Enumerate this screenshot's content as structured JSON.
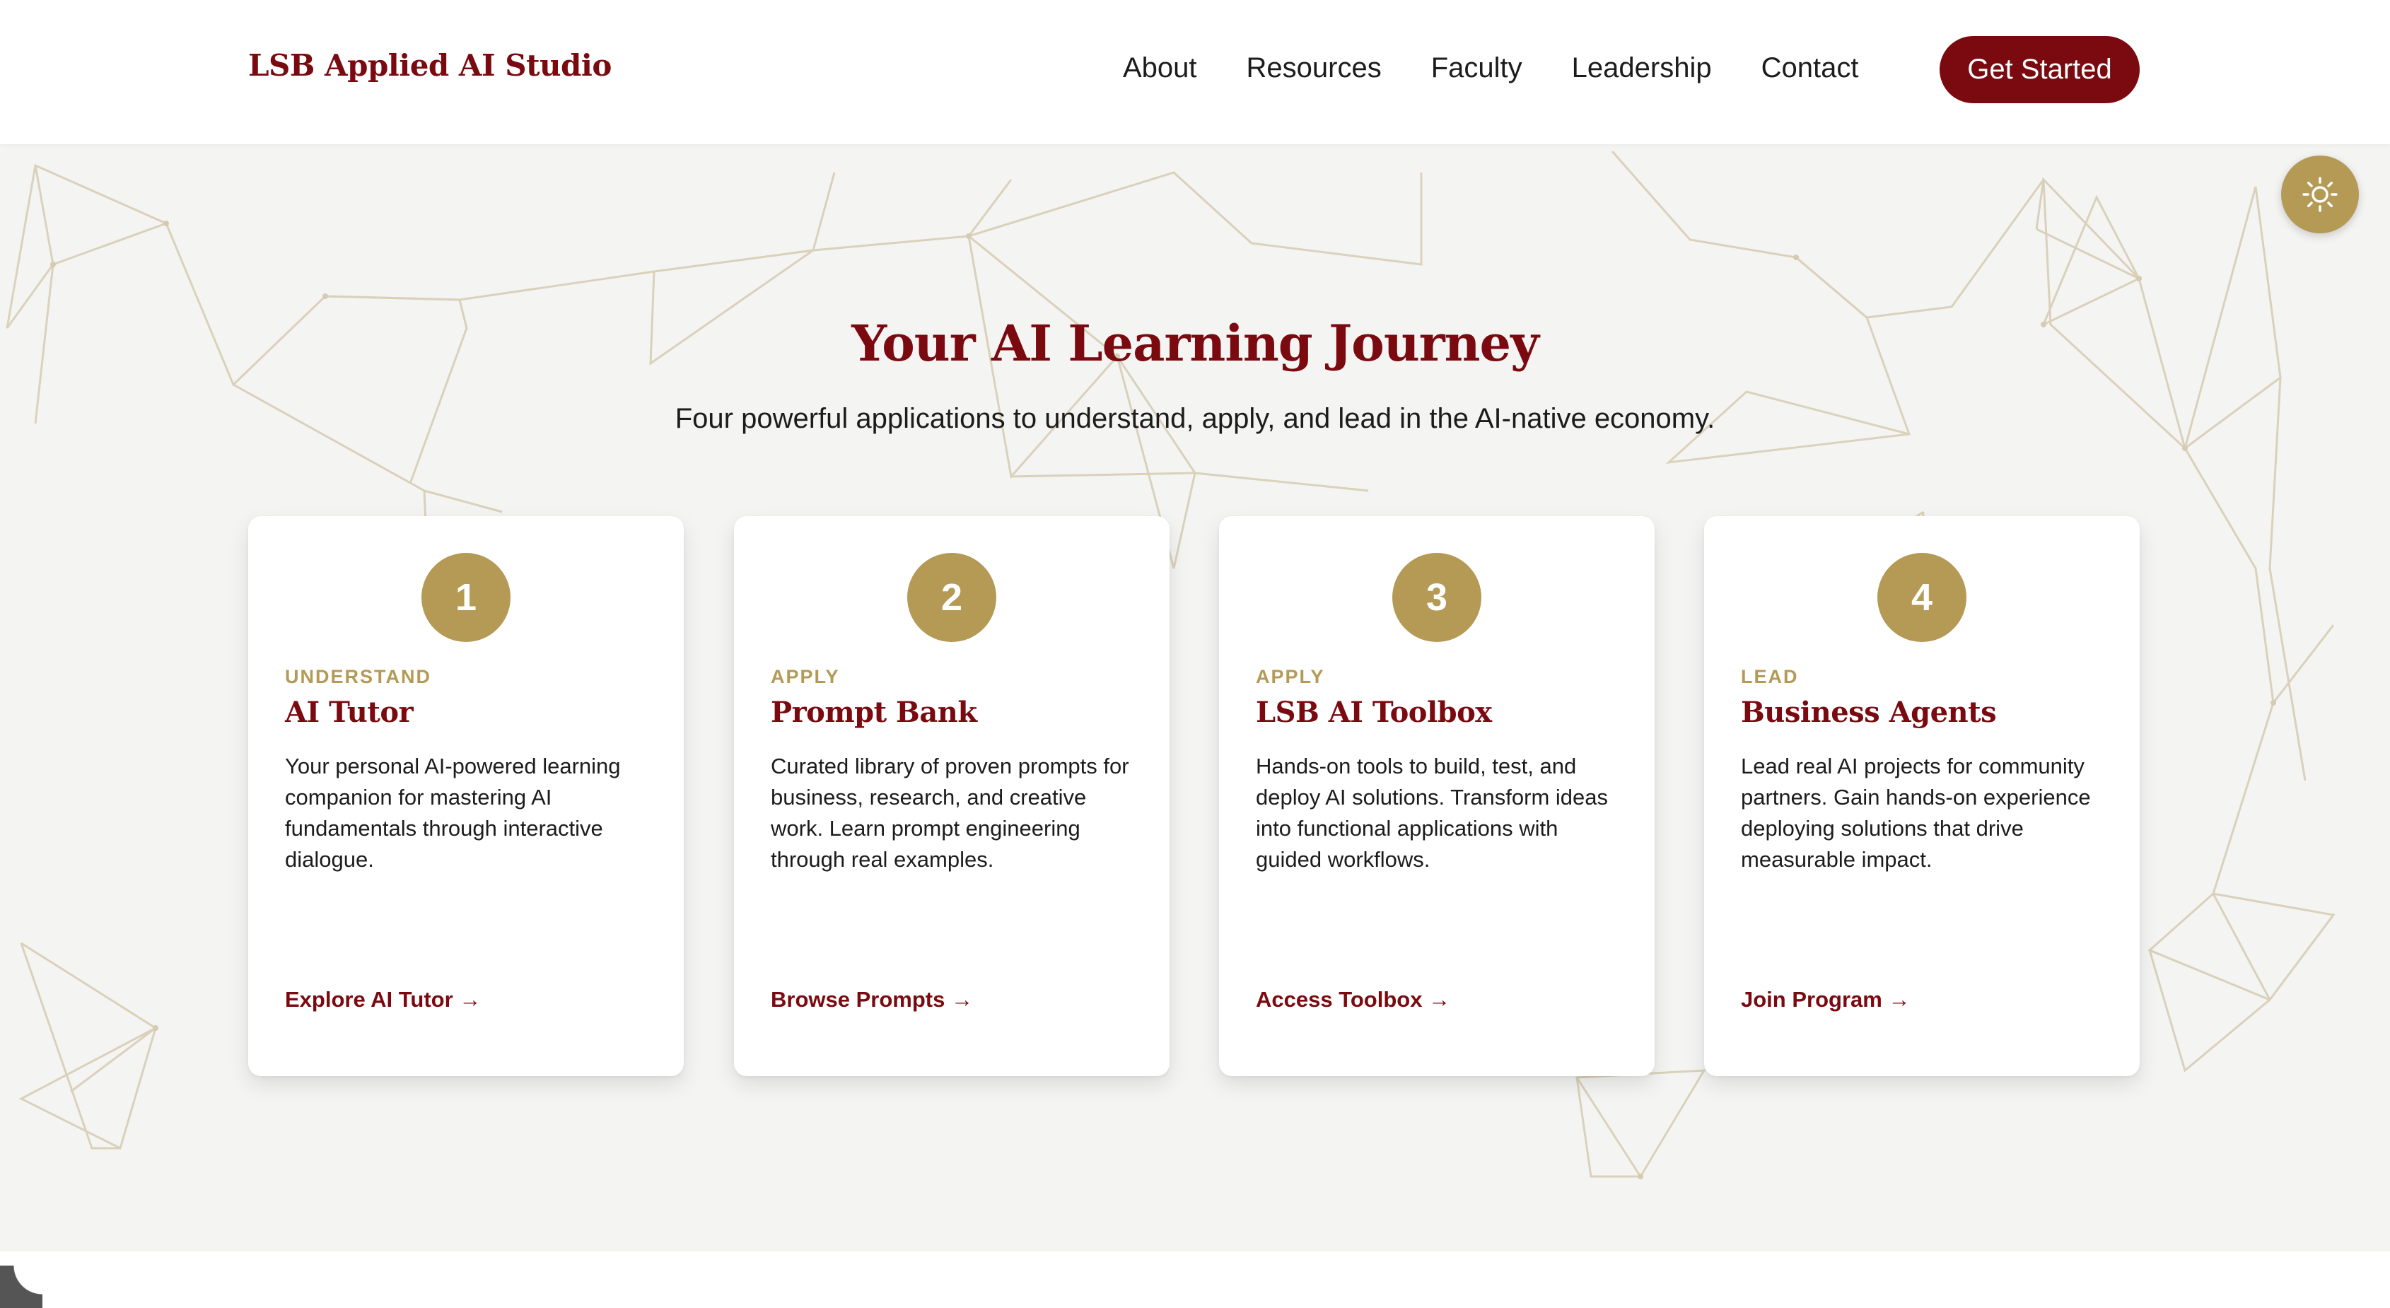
{
  "header": {
    "brand": "LSB Applied AI Studio",
    "nav": [
      "About",
      "Resources",
      "Faculty",
      "Leadership",
      "Contact"
    ],
    "cta_label": "Get Started"
  },
  "theme_toggle": {
    "icon": "sun-icon"
  },
  "hero": {
    "title": "Your AI Learning Journey",
    "subtitle": "Four powerful applications to understand, apply, and lead in the AI-native economy."
  },
  "cards": [
    {
      "number": "1",
      "stage": "UNDERSTAND",
      "title": "AI Tutor",
      "description": "Your personal AI-powered learning companion for mastering AI fundamentals through interactive dialogue.",
      "link": "Explore AI Tutor →"
    },
    {
      "number": "2",
      "stage": "APPLY",
      "title": "Prompt Bank",
      "description": "Curated library of proven prompts for business, research, and creative work. Learn prompt engineering through real examples.",
      "link": "Browse Prompts →"
    },
    {
      "number": "3",
      "stage": "APPLY",
      "title": "LSB AI Toolbox",
      "description": "Hands-on tools to build, test, and deploy AI solutions. Transform ideas into functional applications with guided workflows.",
      "link": "Access Toolbox →"
    },
    {
      "number": "4",
      "stage": "LEAD",
      "title": "Business Agents",
      "description": "Lead real AI projects for community partners. Gain hands-on experience deploying solutions that drive measurable impact.",
      "link": "Join Program →"
    }
  ],
  "colors": {
    "brand_maroon": "#7a0a10",
    "accent_gold": "#b49a55",
    "hero_background": "#f4f4f3",
    "network_lines": "#d8cdb4"
  }
}
